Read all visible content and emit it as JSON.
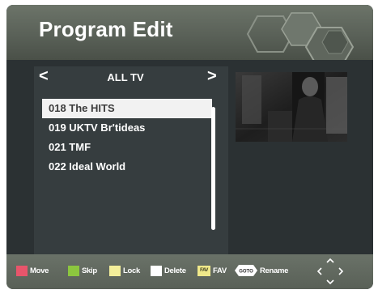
{
  "header": {
    "title": "Program Edit"
  },
  "group": {
    "prev": "<",
    "name": "ALL TV",
    "next": ">"
  },
  "channels": [
    {
      "label": "018 The HITS"
    },
    {
      "label": "019 UKTV Br'tideas"
    },
    {
      "label": "021 TMF"
    },
    {
      "label": "022 Ideal World"
    }
  ],
  "selected_index": 0,
  "footer": {
    "move": "Move",
    "skip": "Skip",
    "lock": "Lock",
    "delete": "Delete",
    "fav_icon": "FAV",
    "fav": "FAV",
    "goto_icon": "GOTO",
    "rename": "Rename"
  },
  "colors": {
    "move": "#e8556b",
    "skip": "#8cc63f",
    "lock": "#f3ee9a",
    "delete": "#ffffff"
  }
}
